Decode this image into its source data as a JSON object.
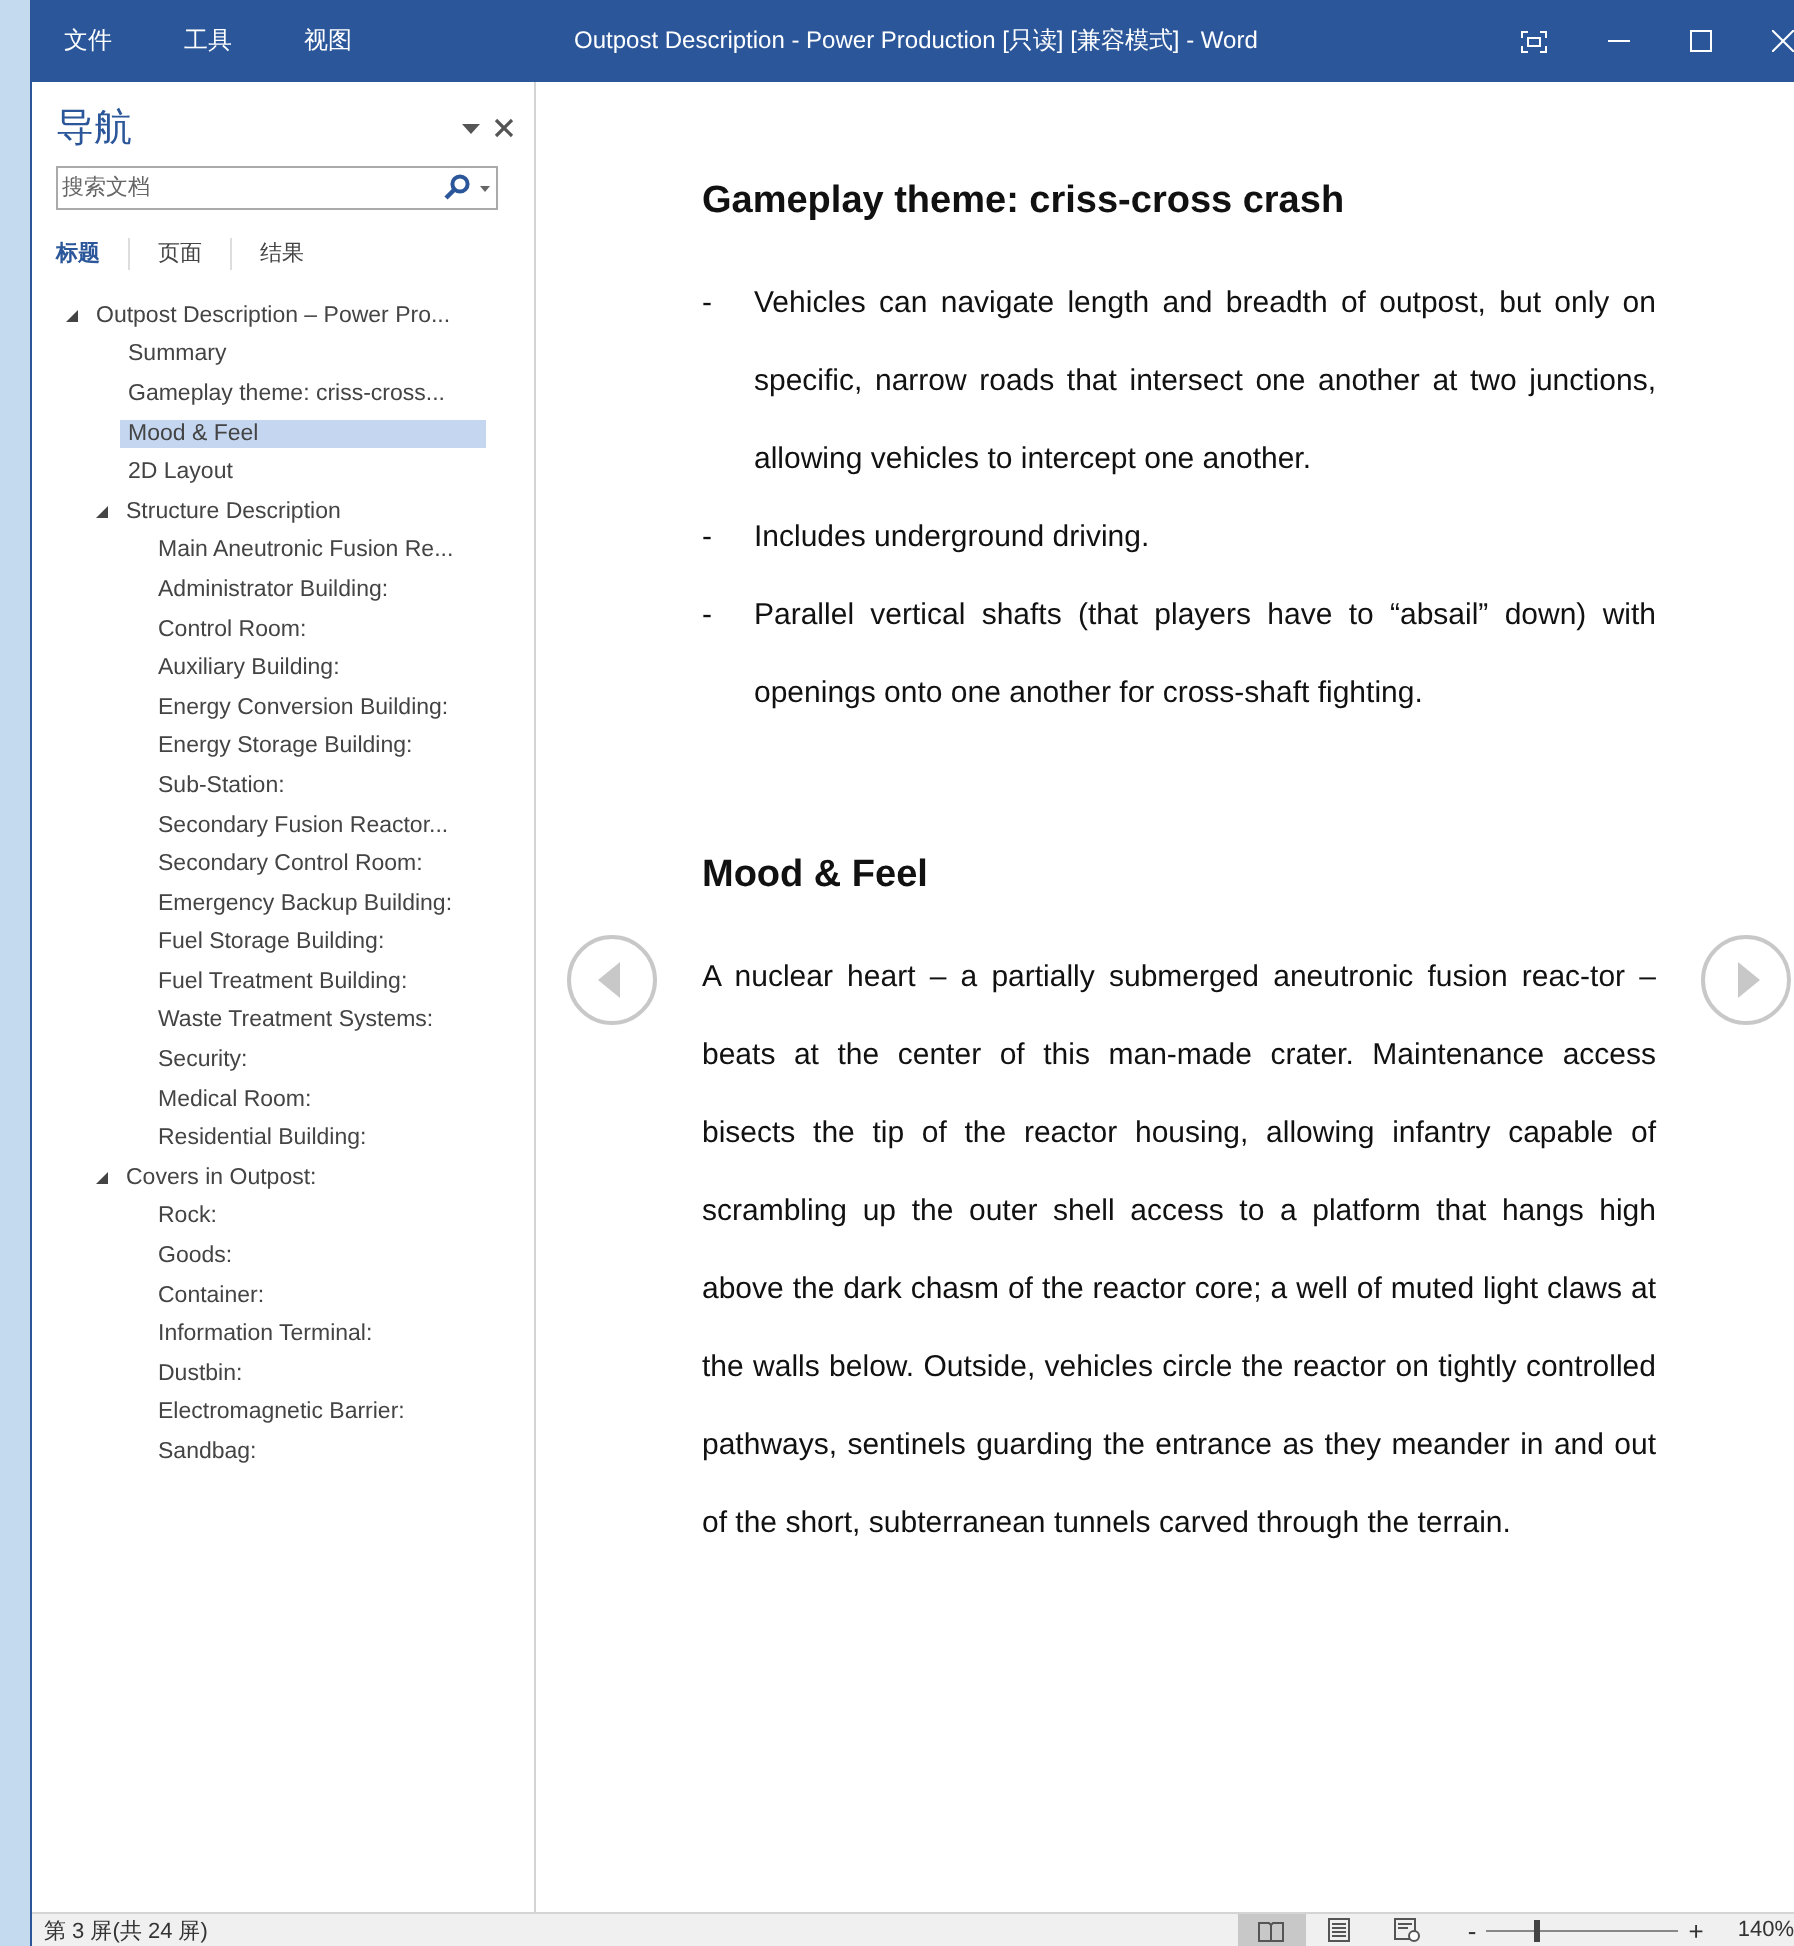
{
  "window": {
    "menu": [
      "文件",
      "工具",
      "视图"
    ],
    "title": "Outpost Description - Power Production [只读] [兼容模式] - Word"
  },
  "navigation": {
    "title": "导航",
    "search": {
      "placeholder": "搜索文档"
    },
    "tabs": [
      {
        "label": "标题",
        "selected": true
      },
      {
        "label": "页面",
        "selected": false
      },
      {
        "label": "结果",
        "selected": false
      }
    ],
    "tree": [
      {
        "label": "Outpost Description – Power Pro...",
        "selected": false,
        "expanded": true,
        "children": [
          {
            "label": "Summary",
            "selected": false
          },
          {
            "label": "Gameplay theme: criss-cross...",
            "selected": false
          },
          {
            "label": "Mood & Feel",
            "selected": true
          },
          {
            "label": "2D Layout",
            "selected": false
          },
          {
            "label": "Structure Description",
            "selected": false,
            "expanded": true,
            "children": [
              {
                "label": "Main Aneutronic Fusion Re...",
                "selected": false
              },
              {
                "label": "Administrator Building:",
                "selected": false
              },
              {
                "label": "Control Room:",
                "selected": false
              },
              {
                "label": "Auxiliary Building:",
                "selected": false
              },
              {
                "label": "Energy Conversion Building:",
                "selected": false
              },
              {
                "label": "Energy Storage Building:",
                "selected": false
              },
              {
                "label": "Sub-Station:",
                "selected": false
              },
              {
                "label": "Secondary Fusion Reactor...",
                "selected": false
              },
              {
                "label": "Secondary Control Room:",
                "selected": false
              },
              {
                "label": "Emergency Backup Building:",
                "selected": false
              },
              {
                "label": "Fuel Storage Building:",
                "selected": false
              },
              {
                "label": "Fuel Treatment Building:",
                "selected": false
              },
              {
                "label": "Waste Treatment Systems:",
                "selected": false
              },
              {
                "label": "Security:",
                "selected": false
              },
              {
                "label": "Medical Room:",
                "selected": false
              },
              {
                "label": "Residential Building:",
                "selected": false
              }
            ]
          },
          {
            "label": "Covers in Outpost:",
            "selected": false,
            "expanded": true,
            "children": [
              {
                "label": "Rock:",
                "selected": false
              },
              {
                "label": "Goods:",
                "selected": false
              },
              {
                "label": "Container:",
                "selected": false
              },
              {
                "label": "Information Terminal:",
                "selected": false
              },
              {
                "label": "Dustbin:",
                "selected": false
              },
              {
                "label": "Electromagnetic Barrier:",
                "selected": false
              },
              {
                "label": "Sandbag:",
                "selected": false
              }
            ]
          }
        ]
      }
    ]
  },
  "document": {
    "sections": [
      {
        "heading": "Gameplay theme: criss-cross crash",
        "bullets": [
          {
            "marker": "-",
            "text": "Vehicles can navigate length and breadth of outpost, but only on specific, narrow roads that intersect one another at two junctions, allowing vehicles to intercept one another."
          },
          {
            "marker": "-",
            "text": "Includes underground driving."
          },
          {
            "marker": "-",
            "text": "Parallel vertical shafts (that players have to “absail” down) with openings onto one another for cross-shaft fighting."
          }
        ]
      },
      {
        "heading": "Mood & Feel",
        "paragraph": "A nuclear heart – a partially submerged aneutronic fusion reac-tor – beats at the center of this man-made crater. Maintenance access bisects the tip of the reactor housing, allowing infantry capable of scrambling up the outer shell access to a platform that hangs high above the dark chasm of the reactor core; a well of muted light claws at the walls below. Outside, vehicles circle the reactor on tightly controlled pathways, sentinels guarding the entrance as they meander in and out of the short, subterranean tunnels carved through the terrain."
      }
    ]
  },
  "status_bar": {
    "page": "第 3 屏(共 24 屏)",
    "views": [
      {
        "kind": "read",
        "selected": true
      },
      {
        "kind": "print",
        "selected": false
      },
      {
        "kind": "web",
        "selected": false
      }
    ],
    "zoom": {
      "minus": "-",
      "plus": "+",
      "level": 0.25,
      "reading": "140%"
    }
  }
}
